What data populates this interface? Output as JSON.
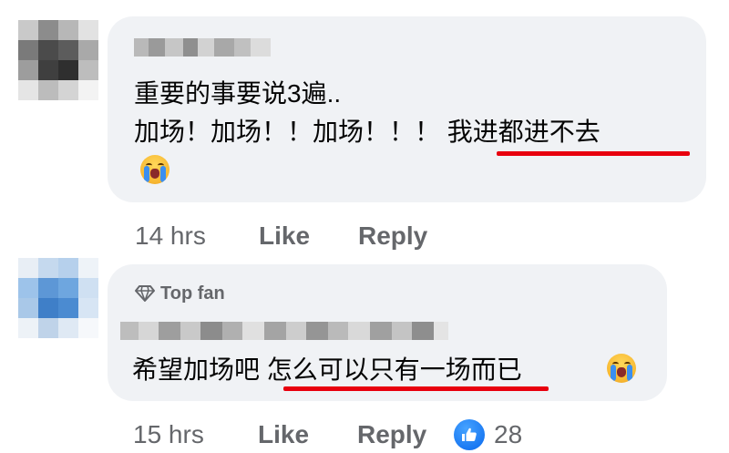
{
  "comments": [
    {
      "author_visible": false,
      "badge": "",
      "lines": [
        "重要的事要说3遍..",
        "加场！加场！！加场！！！",
        "我进都进不去"
      ],
      "time": "14 hrs",
      "like_label": "Like",
      "reply_label": "Reply",
      "emoji": "loudly-crying-face-icon"
    },
    {
      "author_visible": false,
      "badge": "Top fan",
      "text_prefix": "希望加场吧 ",
      "text_underlined": "怎么可以只有一场",
      "text_suffix": "而已",
      "time": "15 hrs",
      "like_label": "Like",
      "reply_label": "Reply",
      "emoji": "loudly-crying-face-icon",
      "reactions": {
        "icon": "thumbs-up-icon",
        "count": "28"
      }
    }
  ],
  "colors": {
    "bubble": "#f0f2f5",
    "meta_text": "#65676b",
    "body_text": "#050505",
    "highlight_underline": "#e8000e",
    "like_blue": "#1877f2"
  }
}
